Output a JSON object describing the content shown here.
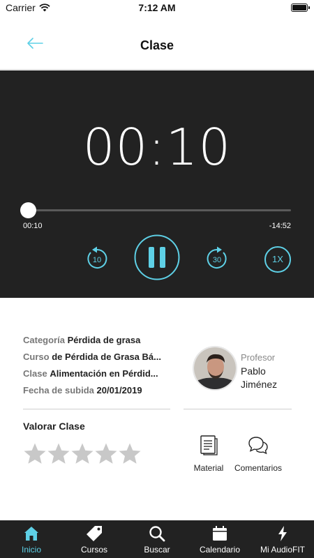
{
  "status_bar": {
    "carrier": "Carrier",
    "time": "7:12 AM"
  },
  "header": {
    "title": "Clase"
  },
  "player": {
    "timer": "00:10",
    "elapsed": "00:10",
    "remaining": "-14:52",
    "progress_fraction": 0.011,
    "rewind_seconds": "10",
    "forward_seconds": "30",
    "speed": "1X",
    "state": "playing",
    "accent_color": "#5ed0e6"
  },
  "info": {
    "category_label": "Categoría",
    "category_value": "Pérdida de grasa",
    "course_label": "Curso",
    "course_value": "de Pérdida de Grasa Bá...",
    "class_label": "Clase",
    "class_value": "Alimentación en Pérdid...",
    "date_label": "Fecha de subida",
    "date_value": "20/01/2019"
  },
  "professor": {
    "role": "Profesor",
    "name": "Pablo Jiménez"
  },
  "rating": {
    "title": "Valorar Clase",
    "max_stars": 5,
    "value": 0
  },
  "actions": [
    {
      "label": "Material",
      "icon": "document-icon"
    },
    {
      "label": "Comentarios",
      "icon": "chat-bubbles-icon"
    }
  ],
  "tabs": [
    {
      "label": "Inicio",
      "icon": "home-icon",
      "active": true
    },
    {
      "label": "Cursos",
      "icon": "tag-icon",
      "active": false
    },
    {
      "label": "Buscar",
      "icon": "search-icon",
      "active": false
    },
    {
      "label": "Calendario",
      "icon": "calendar-icon",
      "active": false
    },
    {
      "label": "Mi AudioFIT",
      "icon": "lightning-icon",
      "active": false
    }
  ]
}
